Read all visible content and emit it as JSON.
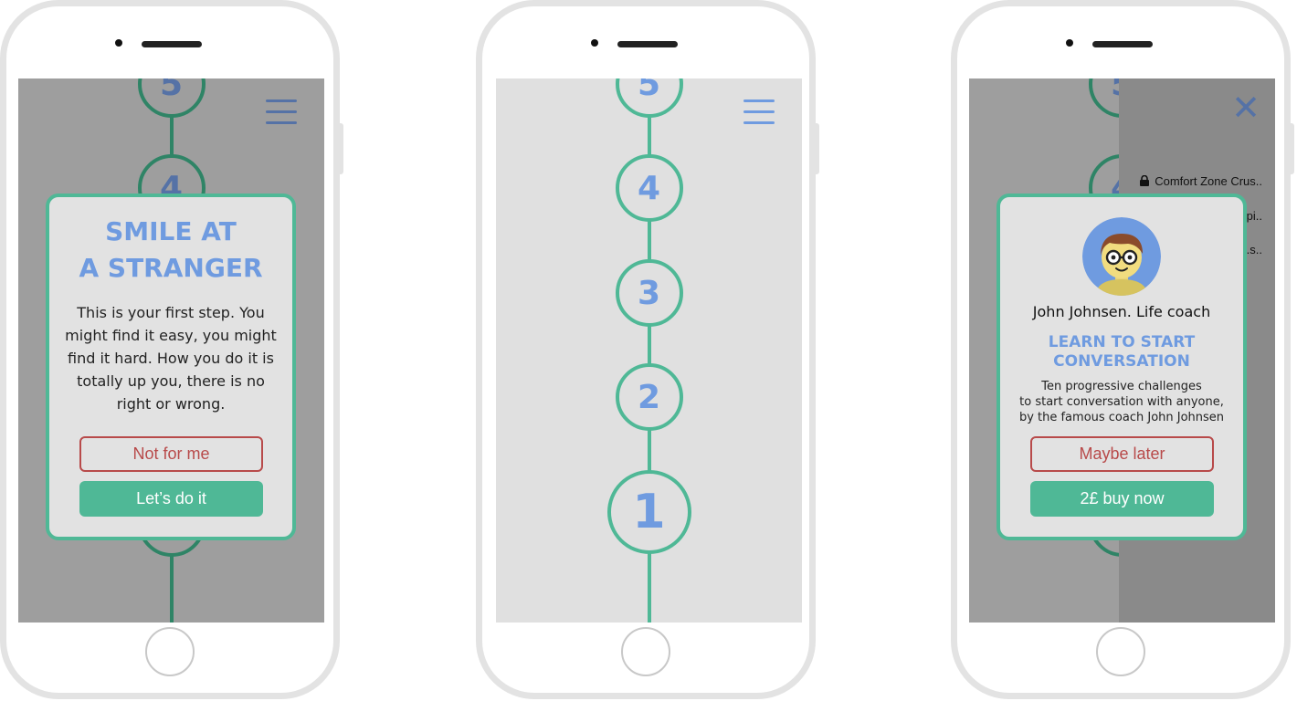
{
  "colors": {
    "accent_green": "#4fb896",
    "accent_blue": "#6f9be0",
    "danger_red": "#b84a4a",
    "screen_bg": "#e0e0e0",
    "overlay_bg": "#9e9e9e"
  },
  "icons": {
    "menu": "hamburger-menu-icon",
    "close": "close-x-icon",
    "lock": "lock-icon",
    "avatar": "coach-avatar-illustration"
  },
  "phone1": {
    "visible_steps": [
      "5",
      "4"
    ],
    "modal": {
      "title_line1": "SMILE AT",
      "title_line2": "A STRANGER",
      "body": "This is your first step. You might find it easy, you might find it hard. How you do it is totally up you, there is no right or wrong.",
      "decline_label": "Not for me",
      "accept_label": "Let’s do it"
    }
  },
  "phone2": {
    "steps": [
      "5",
      "4",
      "3",
      "2",
      "1"
    ]
  },
  "phone3": {
    "visible_steps": [
      "5",
      "4"
    ],
    "drawer": {
      "items": [
        "Comfort Zone Crus..",
        "...pi..",
        "...s.."
      ]
    },
    "modal": {
      "coach_name": "John Johnsen. Life coach",
      "heading_line1": "LEARN TO START",
      "heading_line2": "CONVERSATION",
      "desc_line1": "Ten progressive challenges",
      "desc_line2": "to start conversation with anyone,",
      "desc_line3": "by the famous coach John Johnsen",
      "decline_label": "Maybe later",
      "buy_label": "2£ buy now"
    }
  }
}
